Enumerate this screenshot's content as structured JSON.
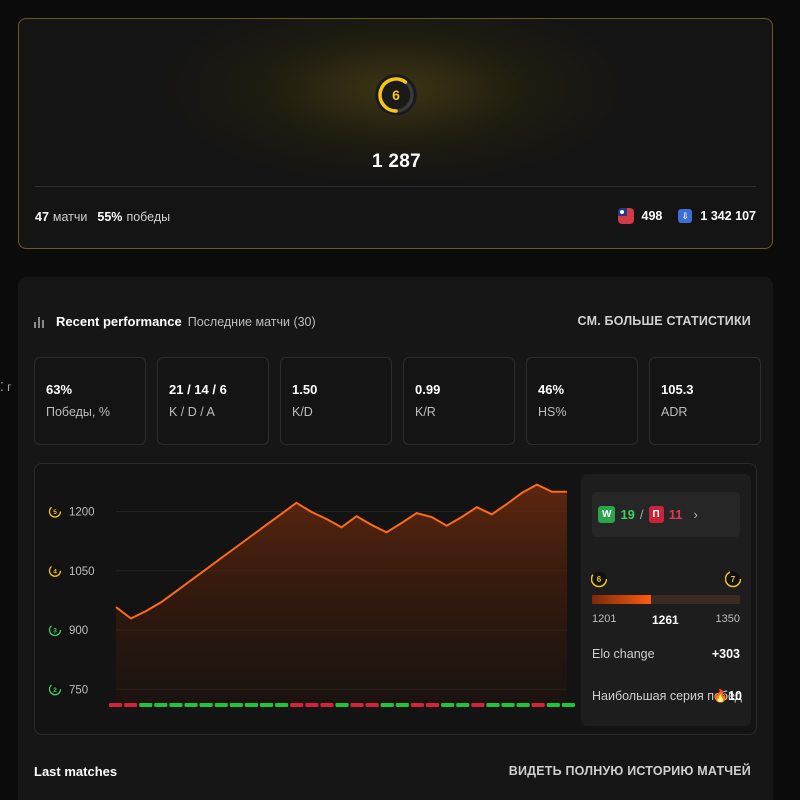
{
  "profile": {
    "level": "6",
    "elo": "1 287",
    "matches_value": "47",
    "matches_label": "матчи",
    "winrate_value": "55%",
    "winrate_label": "победы",
    "country_rank": "498",
    "global_rank": "1 342 107",
    "flag_icon": "taiwan-flag-icon",
    "global_icon": "ranking-icon",
    "level_color": "#f5c518"
  },
  "performance": {
    "title": "Recent performance",
    "subtitle": "Последние матчи (30)",
    "more_link": "СМ. БОЛЬШЕ СТАТИСТИКИ",
    "stats": [
      {
        "value": "63%",
        "label": "Победы, %"
      },
      {
        "value": "21 / 14 / 6",
        "label": "K / D / A"
      },
      {
        "value": "1.50",
        "label": "K/D"
      },
      {
        "value": "0.99",
        "label": "K/R"
      },
      {
        "value": "46%",
        "label": "HS%"
      },
      {
        "value": "105.3",
        "label": "ADR"
      }
    ]
  },
  "chart_data": {
    "type": "area",
    "title": "",
    "xlabel": "",
    "ylabel": "",
    "ylim": [
      700,
      1300
    ],
    "yticks": [
      750,
      900,
      1050,
      1200
    ],
    "ytick_level_badges": [
      {
        "value": 1200,
        "level": "5"
      },
      {
        "value": 1050,
        "level": "4"
      },
      {
        "value": 900,
        "level": "3"
      },
      {
        "value": 750,
        "level": "2"
      }
    ],
    "series": [
      {
        "values": [
          958,
          929,
          948,
          970,
          998,
          1026,
          1054,
          1082,
          1110,
          1138,
          1166,
          1194,
          1222,
          1199,
          1181,
          1160,
          1188,
          1166,
          1147,
          1171,
          1196,
          1186,
          1164,
          1186,
          1211,
          1193,
          1219,
          1247,
          1268,
          1250,
          1250
        ]
      }
    ],
    "results": [
      "L",
      "L",
      "W",
      "W",
      "W",
      "W",
      "W",
      "W",
      "W",
      "W",
      "W",
      "W",
      "L",
      "L",
      "L",
      "W",
      "L",
      "L",
      "W",
      "W",
      "L",
      "L",
      "W",
      "W",
      "L",
      "W",
      "W",
      "W",
      "L",
      "W",
      "W"
    ],
    "colors": {
      "line": "#ff6a1a",
      "win": "#22c33a",
      "loss": "#d0243a",
      "grid": "#242424"
    }
  },
  "summary": {
    "wins_badge": "W",
    "wins": "19",
    "losses_badge": "П",
    "losses": "11",
    "separator": "/",
    "chevron": "›",
    "current_level": "6",
    "next_level": "7",
    "range_min": "1201",
    "range_current": "1261",
    "range_max": "1350",
    "progress_fraction": 0.4,
    "elo_change_label": "Elo change",
    "elo_change_value": "+303",
    "streak_label": "Наибольшая серия побед",
    "streak_value": "10",
    "streak_icon": "fire-icon"
  },
  "matches": {
    "title": "Last matches",
    "full_history_link": "ВИДЕТЬ ПОЛНУЮ ИСТОРИЮ МАТЧЕЙ"
  },
  "edge_fragment": "г"
}
